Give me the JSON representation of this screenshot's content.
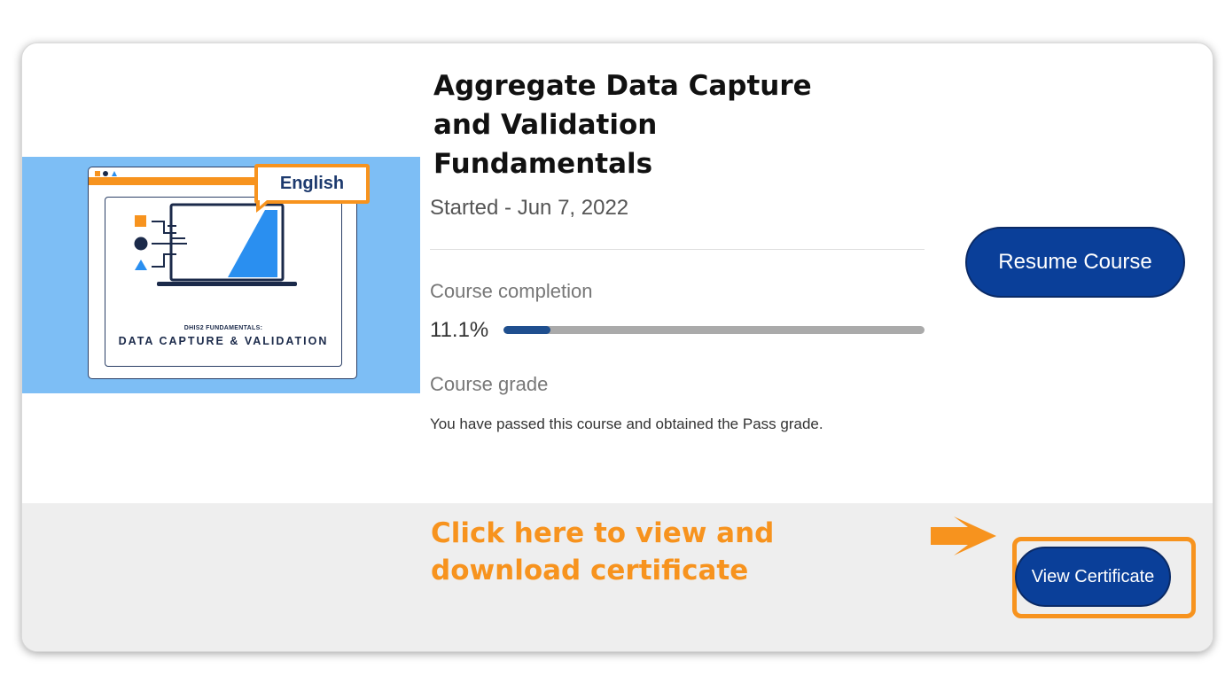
{
  "course": {
    "title": "Aggregate Data Capture and Validation Fundamentals",
    "started": "Started - Jun 7, 2022",
    "completion_label": "Course completion",
    "completion_value": "11.1%",
    "completion_fraction": 0.111,
    "grade_label": "Course grade",
    "grade_text": "You have passed this course and obtained the Pass grade."
  },
  "thumbnail": {
    "language": "English",
    "subtitle": "DHIS2 FUNDAMENTALS:",
    "main_title": "DATA CAPTURE & VALIDATION",
    "icons": [
      "square-icon",
      "circle-icon",
      "triangle-icon",
      "laptop-icon"
    ]
  },
  "actions": {
    "resume_label": "Resume Course",
    "certificate_label": "View Certificate"
  },
  "annotation": {
    "text": "Click here to view and download certificate",
    "arrow_icon": "arrow-right-icon"
  },
  "colors": {
    "primary": "#0a3f99",
    "accent": "#f7931e",
    "thumbnail_bg": "#7dbef5",
    "progress_fill": "#1f4f8f",
    "progress_track": "#aaaaaa"
  }
}
